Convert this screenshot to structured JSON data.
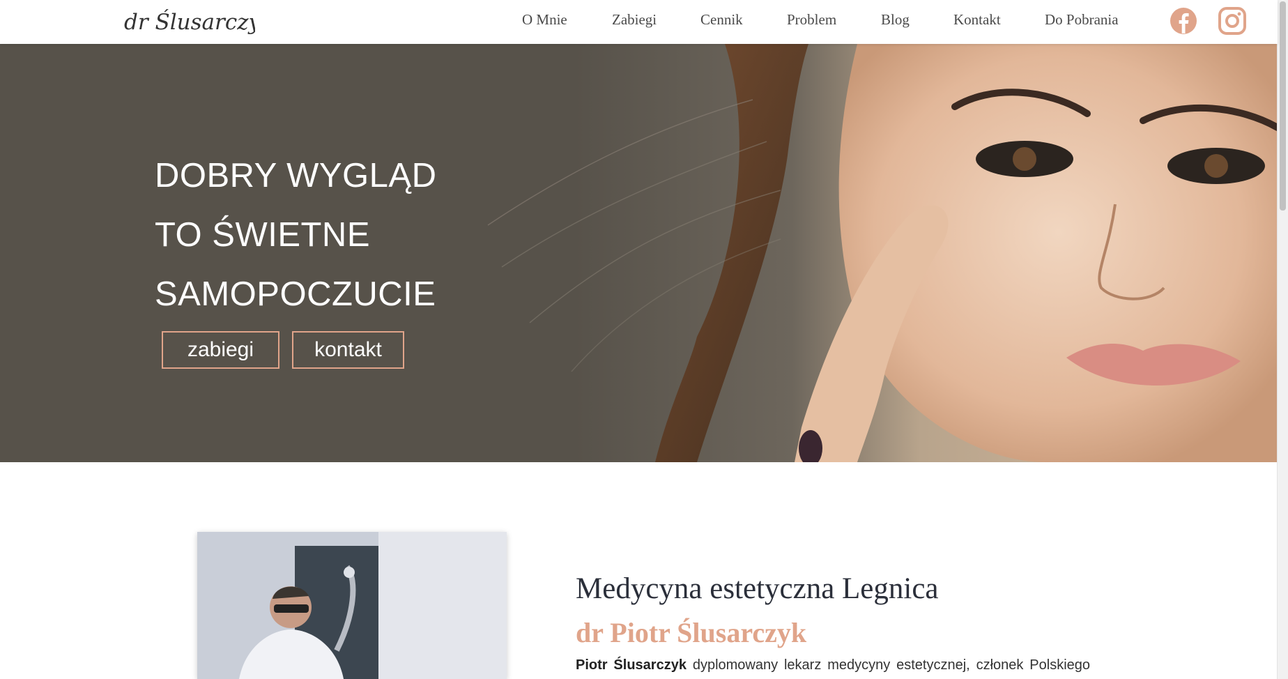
{
  "brand": {
    "logo_text": "dr Ślusarczyk"
  },
  "nav": {
    "items": [
      {
        "label": "O Mnie"
      },
      {
        "label": "Zabiegi"
      },
      {
        "label": "Cennik"
      },
      {
        "label": "Problem"
      },
      {
        "label": "Blog"
      },
      {
        "label": "Kontakt"
      },
      {
        "label": "Do Pobrania"
      }
    ]
  },
  "social": {
    "facebook_icon": "facebook-icon",
    "instagram_icon": "instagram-icon"
  },
  "colors": {
    "accent": "#e0a48a",
    "hero_bg": "#57524a",
    "heading": "#2b2f3a"
  },
  "hero": {
    "headline": [
      "DOBRY WYGLĄD",
      "TO ŚWIETNE",
      "SAMOPOCZUCIE"
    ],
    "buttons": [
      {
        "label": "zabiegi"
      },
      {
        "label": "kontakt"
      }
    ]
  },
  "about": {
    "title": "Medycyna estetyczna Legnica",
    "subtitle": "dr Piotr Ślusarczyk",
    "text_bold": "Piotr Ślusarczyk",
    "text_rest": " dyplomowany lekarz medycyny estetycznej, członek Polskiego"
  }
}
